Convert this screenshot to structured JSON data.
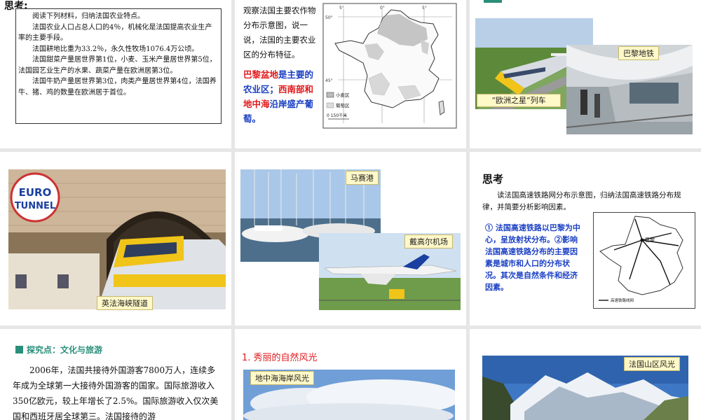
{
  "slide1": {
    "heading": "思考:",
    "paragraphs": [
      "阅读下列材料，归纳法国农业特点。",
      "法国农业人口占总人口的4％，机械化是法国提高农业生产率的主要手段。",
      "法国耕地比重为33.2％，永久性牧场1076.4万公顷。",
      "法国甜菜产量居世界第1位，小麦、玉米产量居世界第5位，法国园艺业生产的水果、蔬菜产量在欧洲居第3位。",
      "法国牛奶产量居世界第3位，肉类产量居世界第4位，法国养牛、猪、鸡的数量在欧洲居于首位。"
    ]
  },
  "slide2": {
    "question": "观察法国主要农作物分布示意图，说一说，法国的主要农业区的分布特征。",
    "answer_part1": "巴黎盆地",
    "answer_part2": "是主要的农业区；",
    "answer_part3": "西南部和地中海",
    "answer_part4": "沿岸盛产葡萄。",
    "map_legend_wheat": "小麦区",
    "map_legend_grape": "葡萄区",
    "map_scale": "0  150千米",
    "map_lat_top": "50°",
    "map_lat_bottom": "45°",
    "map_lon_left": "5°",
    "map_lon_mid": "0°",
    "map_lon_right": "5°"
  },
  "slide3": {
    "caption_metro": "巴黎地铁",
    "caption_train": "“欧洲之星”列车"
  },
  "slide4": {
    "logo_line1": "EURO",
    "logo_line2": "TUNNEL",
    "caption": "英法海峡隧道"
  },
  "slide5": {
    "caption_port": "马赛港",
    "caption_airport": "戴高尔机场"
  },
  "slide6": {
    "heading": "思考",
    "question": "读法国高速铁路网分布示意图，归纳法国高速铁路分布规律，并简要分析影响因素。",
    "answer": "① 法国高速铁路以巴黎为中心，呈放射状分布。②影响法国高速铁路分布的主要因素是城市和人口的分布状况。其次是自然条件和经济因素。",
    "map_label_city": "巴黎",
    "map_legend": "高速铁路线网"
  },
  "slide7": {
    "section_title": "探究点：文化与旅游",
    "paragraph": "2006年，法国共接待外国游客7800万人，连续多年成为全球第一大接待外国游客的国家。国际旅游收入350亿欧元，较上年增长了2.5%。国际旅游收入仅次美国和西班牙居全球第三。法国接待的游"
  },
  "slide8": {
    "title": "1. 秀丽的自然风光",
    "caption": "地中海海岸风光"
  },
  "slide9": {
    "caption": "法国山区风光"
  },
  "colors": {
    "red": "#e0191b",
    "blue": "#1a3fc4",
    "teal": "#2a8f7a",
    "caption_bg": "#fff8c8"
  }
}
